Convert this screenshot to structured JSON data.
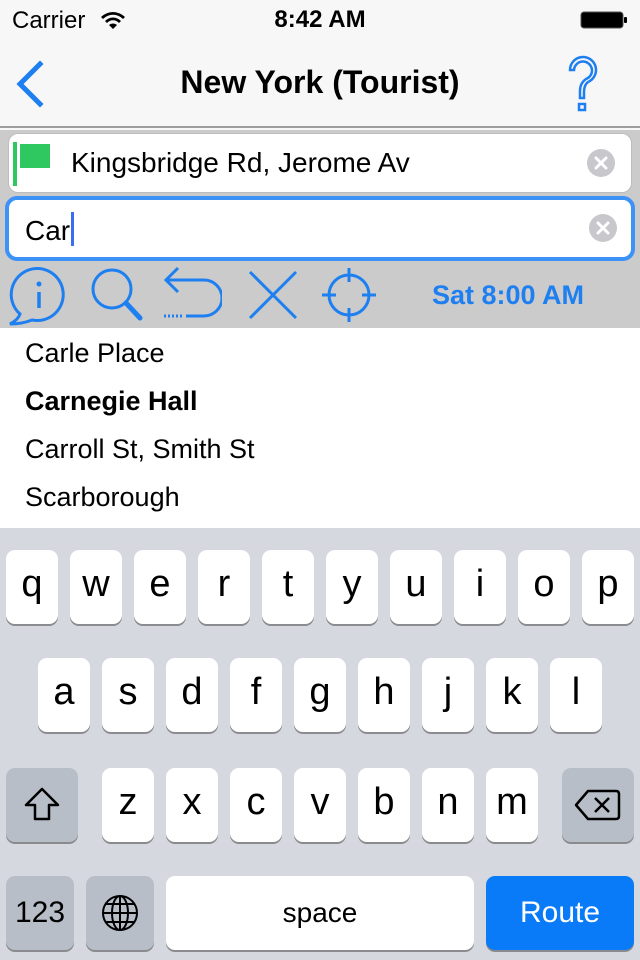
{
  "status_bar": {
    "carrier": "Carrier",
    "time": "8:42 AM",
    "wifi_icon": "wifi-icon",
    "battery_icon": "battery-full-icon"
  },
  "nav_bar": {
    "title": "New York (Tourist)",
    "back_icon": "chevron-left-icon",
    "help_icon": "question-mark-icon"
  },
  "route_inputs": {
    "from": {
      "value": "Kingsbridge Rd, Jerome Av",
      "icon": "green-flag-icon",
      "flag_color": "#2ec760"
    },
    "to": {
      "value": "Car",
      "focused": true
    },
    "clear_icon": "clear-circle-icon"
  },
  "toolbar": {
    "tools": [
      {
        "name": "info",
        "icon": "info-bubble-icon"
      },
      {
        "name": "search",
        "icon": "magnifier-icon"
      },
      {
        "name": "reverse",
        "icon": "u-turn-arrow-icon"
      },
      {
        "name": "clear",
        "icon": "x-icon"
      },
      {
        "name": "locate",
        "icon": "crosshair-icon"
      }
    ],
    "datetime": "Sat 8:00 AM"
  },
  "suggestions": [
    {
      "label": "Carle Place",
      "bold": false
    },
    {
      "label": "Carnegie Hall",
      "bold": true
    },
    {
      "label": "Carroll St, Smith St",
      "bold": false
    },
    {
      "label": "Scarborough",
      "bold": false
    }
  ],
  "keyboard": {
    "row1": [
      "q",
      "w",
      "e",
      "r",
      "t",
      "y",
      "u",
      "i",
      "o",
      "p"
    ],
    "row2": [
      "a",
      "s",
      "d",
      "f",
      "g",
      "h",
      "j",
      "k",
      "l"
    ],
    "row3": [
      "z",
      "x",
      "c",
      "v",
      "b",
      "n",
      "m"
    ],
    "shift_icon": "shift-arrow-icon",
    "delete_icon": "backspace-icon",
    "numbers_label": "123",
    "globe_icon": "globe-icon",
    "space_label": "space",
    "return_label": "Route"
  },
  "colors": {
    "accent": "#1e7ff0",
    "focus_border": "#3d93f5",
    "return_key": "#0a7bf8",
    "flag": "#2ec760"
  }
}
